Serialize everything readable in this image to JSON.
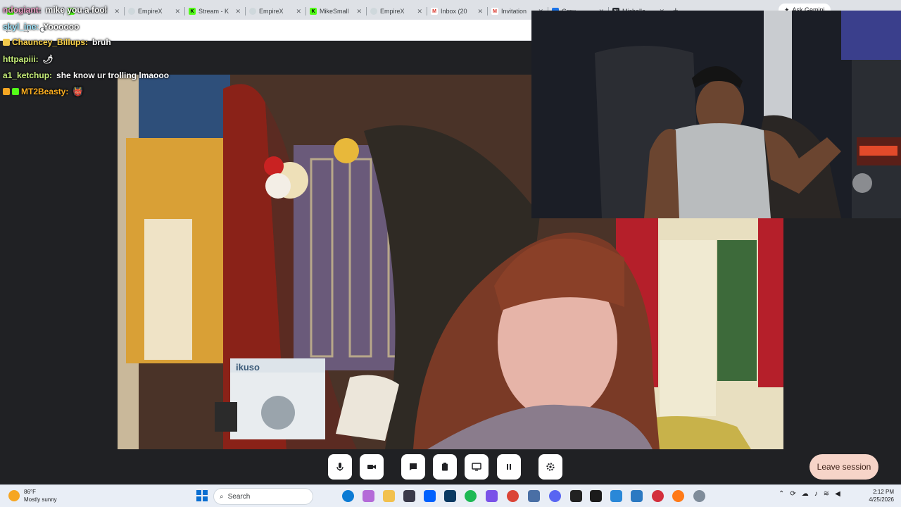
{
  "browser": {
    "tabs": [
      {
        "label": "ndogiant",
        "favicon": "kick-icon"
      },
      {
        "label": "Stream - K",
        "favicon": "kick-icon"
      },
      {
        "label": "EmpireX",
        "favicon": "edge-icon"
      },
      {
        "label": "Stream - K",
        "favicon": "kick-icon"
      },
      {
        "label": "EmpireX",
        "favicon": "edge-icon"
      },
      {
        "label": "MikeSmall",
        "favicon": "kick-icon"
      },
      {
        "label": "EmpireX",
        "favicon": "edge-icon"
      },
      {
        "label": "Inbox (20",
        "favicon": "gmail-icon"
      },
      {
        "label": "Invitation",
        "favicon": "gmail-icon"
      },
      {
        "label": "Grou",
        "favicon": "meet-icon"
      },
      {
        "label": "Michelle",
        "favicon": "notion-icon"
      }
    ],
    "new_tab_label": "+",
    "ask_gemini_label": "Ask Gemini"
  },
  "chat": [
    {
      "user": "ndogiant:",
      "message": "mike you a fool",
      "user_color": "#f0a0c8",
      "top": 0
    },
    {
      "user": "skyl_ine:",
      "message": "Yoooooo",
      "user_color": "#9fe8ff",
      "top": 0
    },
    {
      "user": "Chauncey_Billups:",
      "message": "bruh",
      "user_color": "#ffd54a",
      "top": 0
    },
    {
      "user": "httpapiii:",
      "message": "",
      "user_color": "#c8f07a",
      "top": 0
    },
    {
      "user": "a1_ketchup:",
      "message": "she know ur trolling lmaooo",
      "user_color": "#c8f07a",
      "top": 0
    },
    {
      "user": "MT2Beasty:",
      "message": "",
      "user_color": "#ffb020",
      "top": 0
    }
  ],
  "session": {
    "leave_label": "Leave session",
    "controls": [
      "mic-icon",
      "camera-icon",
      "chat-icon",
      "clipboard-icon",
      "present-icon",
      "pause-icon",
      "settings-icon"
    ]
  },
  "video": {
    "box_brand": "ikuso"
  },
  "taskbar": {
    "weather_temp": "86°F",
    "weather_desc": "Mostly sunny",
    "search_label": "Search",
    "time": "2:12 PM",
    "date": "4/25/2026"
  }
}
